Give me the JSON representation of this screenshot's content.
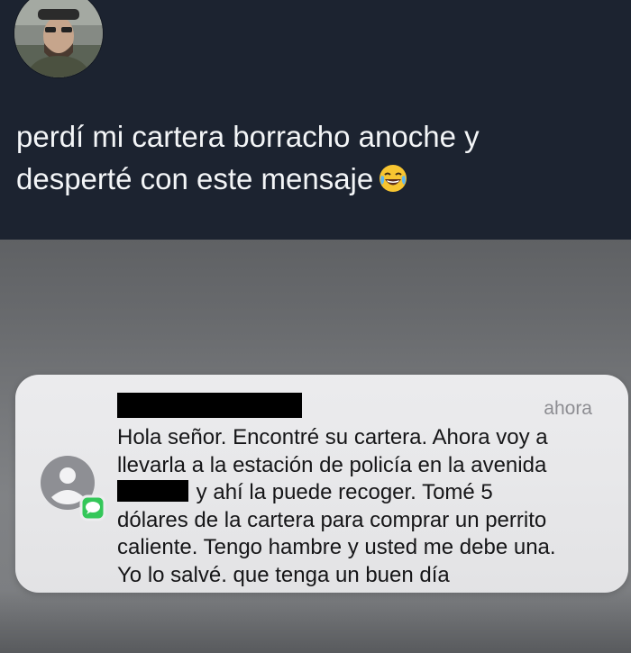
{
  "tweet": {
    "line1": "perdí mi cartera borracho anoche y",
    "line2": "desperté con este mensaje",
    "emoji": "face-with-tears-of-joy-emoji"
  },
  "notification": {
    "time": "ahora",
    "lines": [
      "Hola señor. Encontré su cartera. Ahora voy a",
      "llevarla a la estación de policía en la avenida",
      "y ahí la puede recoger. Tomé 5",
      "dólares de la cartera para comprar un perrito",
      "caliente. Tengo hambre y usted me debe una.",
      "Yo lo salvé. que tenga un buen día"
    ]
  },
  "colors": {
    "header_bg": "#1c2330",
    "header_text": "#f3f5f7",
    "notification_bg": "#f1f1f3",
    "messages_green": "#34c759",
    "redaction": "#000000"
  }
}
